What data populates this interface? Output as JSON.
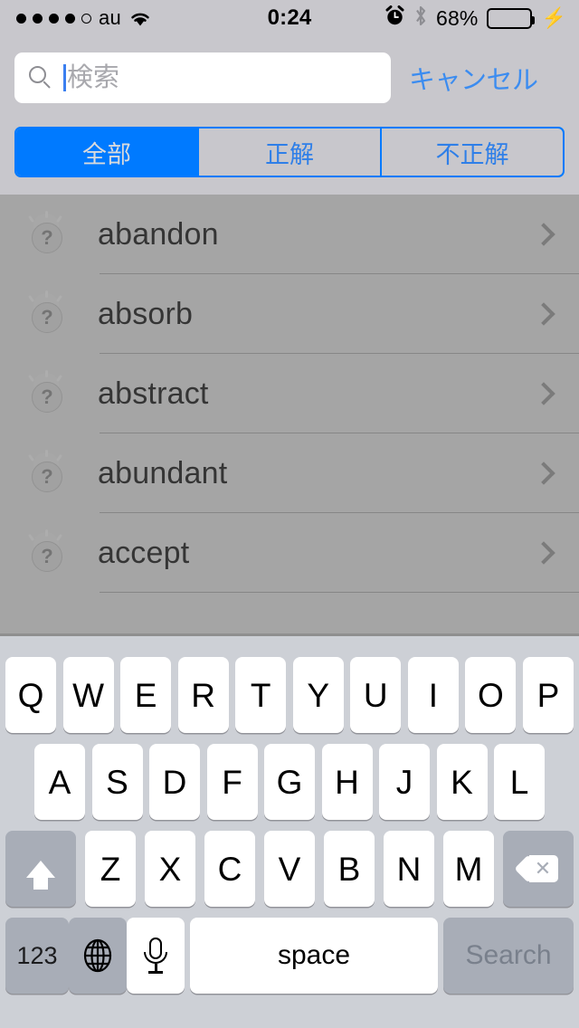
{
  "status_bar": {
    "signal_dots_filled": 4,
    "signal_dots_total": 5,
    "carrier": "au",
    "wifi_icon": "wifi-icon",
    "time": "0:24",
    "alarm_icon": "alarm-clock-icon",
    "bluetooth_icon": "bluetooth-icon",
    "battery_percent": "68%",
    "battery_level": 68,
    "battery_color": "#4cd964",
    "charging_icon": "lightning-bolt-icon"
  },
  "search": {
    "icon": "search-icon",
    "value": "",
    "placeholder": "検索",
    "cancel_label": "キャンセル",
    "cancel_color": "#3b8cf0",
    "caret_color": "#3b7ff0"
  },
  "segmented_control": {
    "accent_color": "#007aff",
    "selected_index": 0,
    "segments": [
      {
        "label": "全部"
      },
      {
        "label": "正解"
      },
      {
        "label": "不正解"
      }
    ]
  },
  "list": {
    "status_icon": "question-badge-icon",
    "disclosure_icon": "chevron-right-icon",
    "rows": [
      {
        "word": "abandon"
      },
      {
        "word": "absorb"
      },
      {
        "word": "abstract"
      },
      {
        "word": "abundant"
      },
      {
        "word": "accept"
      }
    ]
  },
  "keyboard": {
    "row1": [
      "Q",
      "W",
      "E",
      "R",
      "T",
      "Y",
      "U",
      "I",
      "O",
      "P"
    ],
    "row2": [
      "A",
      "S",
      "D",
      "F",
      "G",
      "H",
      "J",
      "K",
      "L"
    ],
    "row3": [
      "Z",
      "X",
      "C",
      "V",
      "B",
      "N",
      "M"
    ],
    "shift_icon": "shift-arrow-icon",
    "delete_icon": "backspace-icon",
    "numbers_label": "123",
    "globe_icon": "globe-icon",
    "dictation_icon": "microphone-icon",
    "space_label": "space",
    "return_label": "Search"
  }
}
